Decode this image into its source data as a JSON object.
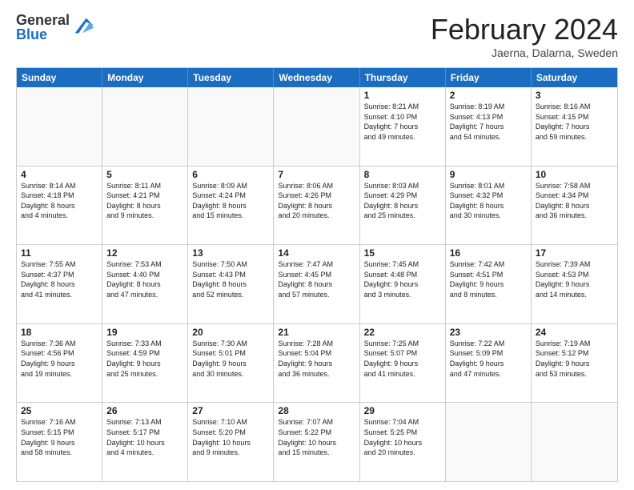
{
  "logo": {
    "general": "General",
    "blue": "Blue"
  },
  "title": "February 2024",
  "subtitle": "Jaerna, Dalarna, Sweden",
  "header_days": [
    "Sunday",
    "Monday",
    "Tuesday",
    "Wednesday",
    "Thursday",
    "Friday",
    "Saturday"
  ],
  "rows": [
    [
      {
        "day": "",
        "info": ""
      },
      {
        "day": "",
        "info": ""
      },
      {
        "day": "",
        "info": ""
      },
      {
        "day": "",
        "info": ""
      },
      {
        "day": "1",
        "info": "Sunrise: 8:21 AM\nSunset: 4:10 PM\nDaylight: 7 hours\nand 49 minutes."
      },
      {
        "day": "2",
        "info": "Sunrise: 8:19 AM\nSunset: 4:13 PM\nDaylight: 7 hours\nand 54 minutes."
      },
      {
        "day": "3",
        "info": "Sunrise: 8:16 AM\nSunset: 4:15 PM\nDaylight: 7 hours\nand 59 minutes."
      }
    ],
    [
      {
        "day": "4",
        "info": "Sunrise: 8:14 AM\nSunset: 4:18 PM\nDaylight: 8 hours\nand 4 minutes."
      },
      {
        "day": "5",
        "info": "Sunrise: 8:11 AM\nSunset: 4:21 PM\nDaylight: 8 hours\nand 9 minutes."
      },
      {
        "day": "6",
        "info": "Sunrise: 8:09 AM\nSunset: 4:24 PM\nDaylight: 8 hours\nand 15 minutes."
      },
      {
        "day": "7",
        "info": "Sunrise: 8:06 AM\nSunset: 4:26 PM\nDaylight: 8 hours\nand 20 minutes."
      },
      {
        "day": "8",
        "info": "Sunrise: 8:03 AM\nSunset: 4:29 PM\nDaylight: 8 hours\nand 25 minutes."
      },
      {
        "day": "9",
        "info": "Sunrise: 8:01 AM\nSunset: 4:32 PM\nDaylight: 8 hours\nand 30 minutes."
      },
      {
        "day": "10",
        "info": "Sunrise: 7:58 AM\nSunset: 4:34 PM\nDaylight: 8 hours\nand 36 minutes."
      }
    ],
    [
      {
        "day": "11",
        "info": "Sunrise: 7:55 AM\nSunset: 4:37 PM\nDaylight: 8 hours\nand 41 minutes."
      },
      {
        "day": "12",
        "info": "Sunrise: 7:53 AM\nSunset: 4:40 PM\nDaylight: 8 hours\nand 47 minutes."
      },
      {
        "day": "13",
        "info": "Sunrise: 7:50 AM\nSunset: 4:43 PM\nDaylight: 8 hours\nand 52 minutes."
      },
      {
        "day": "14",
        "info": "Sunrise: 7:47 AM\nSunset: 4:45 PM\nDaylight: 8 hours\nand 57 minutes."
      },
      {
        "day": "15",
        "info": "Sunrise: 7:45 AM\nSunset: 4:48 PM\nDaylight: 9 hours\nand 3 minutes."
      },
      {
        "day": "16",
        "info": "Sunrise: 7:42 AM\nSunset: 4:51 PM\nDaylight: 9 hours\nand 8 minutes."
      },
      {
        "day": "17",
        "info": "Sunrise: 7:39 AM\nSunset: 4:53 PM\nDaylight: 9 hours\nand 14 minutes."
      }
    ],
    [
      {
        "day": "18",
        "info": "Sunrise: 7:36 AM\nSunset: 4:56 PM\nDaylight: 9 hours\nand 19 minutes."
      },
      {
        "day": "19",
        "info": "Sunrise: 7:33 AM\nSunset: 4:59 PM\nDaylight: 9 hours\nand 25 minutes."
      },
      {
        "day": "20",
        "info": "Sunrise: 7:30 AM\nSunset: 5:01 PM\nDaylight: 9 hours\nand 30 minutes."
      },
      {
        "day": "21",
        "info": "Sunrise: 7:28 AM\nSunset: 5:04 PM\nDaylight: 9 hours\nand 36 minutes."
      },
      {
        "day": "22",
        "info": "Sunrise: 7:25 AM\nSunset: 5:07 PM\nDaylight: 9 hours\nand 41 minutes."
      },
      {
        "day": "23",
        "info": "Sunrise: 7:22 AM\nSunset: 5:09 PM\nDaylight: 9 hours\nand 47 minutes."
      },
      {
        "day": "24",
        "info": "Sunrise: 7:19 AM\nSunset: 5:12 PM\nDaylight: 9 hours\nand 53 minutes."
      }
    ],
    [
      {
        "day": "25",
        "info": "Sunrise: 7:16 AM\nSunset: 5:15 PM\nDaylight: 9 hours\nand 58 minutes."
      },
      {
        "day": "26",
        "info": "Sunrise: 7:13 AM\nSunset: 5:17 PM\nDaylight: 10 hours\nand 4 minutes."
      },
      {
        "day": "27",
        "info": "Sunrise: 7:10 AM\nSunset: 5:20 PM\nDaylight: 10 hours\nand 9 minutes."
      },
      {
        "day": "28",
        "info": "Sunrise: 7:07 AM\nSunset: 5:22 PM\nDaylight: 10 hours\nand 15 minutes."
      },
      {
        "day": "29",
        "info": "Sunrise: 7:04 AM\nSunset: 5:25 PM\nDaylight: 10 hours\nand 20 minutes."
      },
      {
        "day": "",
        "info": ""
      },
      {
        "day": "",
        "info": ""
      }
    ]
  ]
}
